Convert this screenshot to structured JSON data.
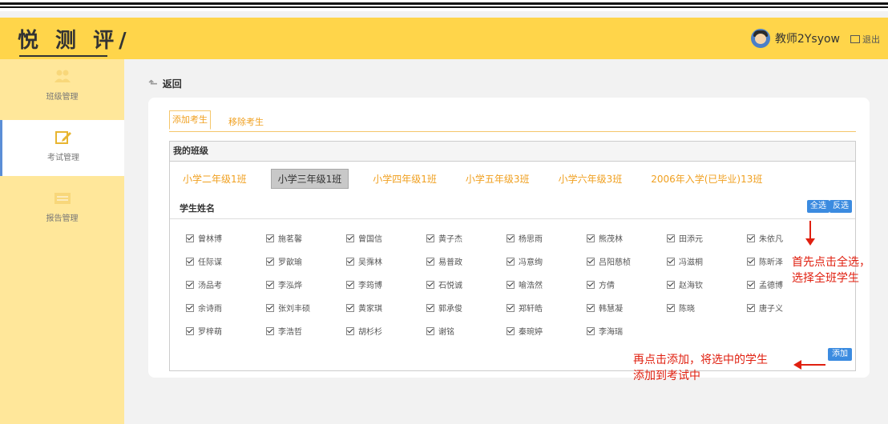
{
  "header": {
    "logo": "悦 测 评",
    "username": "教师2Ysyow",
    "logout": "退出",
    "bg_color": "#ffd54a"
  },
  "sidebar": {
    "items": [
      {
        "label": "班级管理",
        "icon": "group-icon"
      },
      {
        "label": "考试管理",
        "icon": "edit-icon",
        "active": true
      },
      {
        "label": "报告管理",
        "icon": "report-icon"
      }
    ]
  },
  "main": {
    "back_label": "返回",
    "tabs": [
      "添加考生",
      "移除考生"
    ],
    "panel_title": "我的班级",
    "classes": [
      "小学二年级1班",
      "小学三年级1班",
      "小学四年级1班",
      "小学五年级3班",
      "小学六年级3班",
      "2006年入学(已毕业)13班"
    ],
    "selected_class": "小学三年级1班",
    "names_header": "学生姓名",
    "select_all": "全选",
    "invert": "反选",
    "add": "添加",
    "students": [
      [
        "曾林博",
        "施茗馨",
        "曾国信",
        "黄子杰",
        "杨思雨",
        "熊茂林",
        "田添元",
        "朱依凡"
      ],
      [
        "任际谋",
        "罗歆瑜",
        "吴霈林",
        "易普政",
        "冯意绚",
        "吕阳慈桢",
        "冯滋桐",
        "陈昕泽"
      ],
      [
        "汤品考",
        "李泓烨",
        "李筠博",
        "石悦诚",
        "喻浩然",
        "方倩",
        "赵海钦",
        "孟德博"
      ],
      [
        "余诗雨",
        "张刘丰硕",
        "黄家琪",
        "郭承俊",
        "郑轩皓",
        "韩慧凝",
        "陈晓",
        "唐子义"
      ],
      [
        "罗梓萌",
        "李浩哲",
        "胡杉杉",
        "谢铭",
        "秦琬婷",
        "李海瑞"
      ]
    ]
  },
  "annotations": {
    "first": [
      "首先点击全选，",
      "选择全班学生"
    ],
    "second": [
      "再点击添加，将选中的学生",
      "添加到考试中"
    ]
  }
}
